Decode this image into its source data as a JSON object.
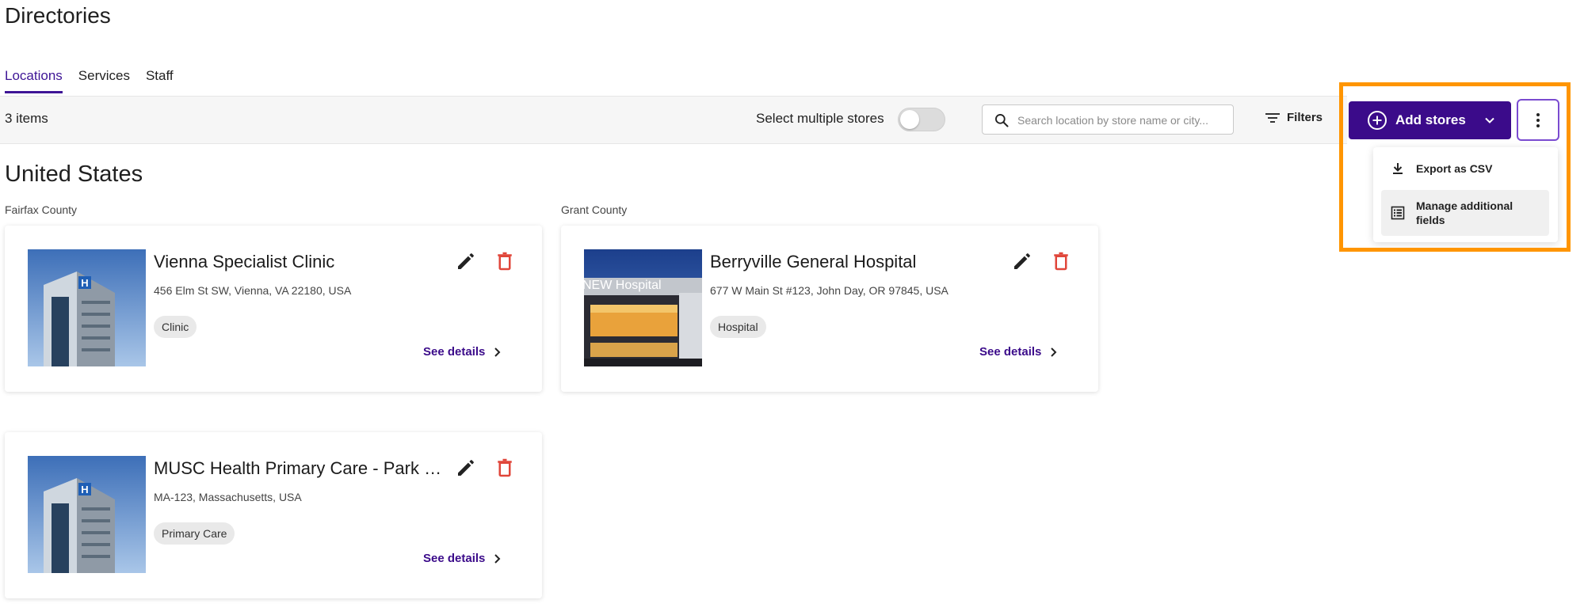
{
  "page": {
    "title": "Directories"
  },
  "tabs": [
    {
      "label": "Locations",
      "active": true
    },
    {
      "label": "Services",
      "active": false
    },
    {
      "label": "Staff",
      "active": false
    }
  ],
  "toolbar": {
    "item_count": "3 items",
    "multi_select_label": "Select multiple stores",
    "multi_select_on": false,
    "search_placeholder": "Search location by store name or city...",
    "filters_label": "Filters",
    "add_stores_label": "Add stores"
  },
  "menu": {
    "items": [
      {
        "label": "Export as CSV",
        "icon": "download-icon"
      },
      {
        "label": "Manage additional fields",
        "icon": "list-icon"
      }
    ]
  },
  "region": {
    "title": "United States"
  },
  "groups": [
    {
      "county": "Fairfax County"
    },
    {
      "county": "Grant County"
    }
  ],
  "cards": [
    {
      "name": "Vienna Specialist Clinic",
      "address": "456 Elm St SW, Vienna, VA 22180, USA",
      "tag": "Clinic",
      "details_label": "See details"
    },
    {
      "name": "Berryville General Hospital",
      "address": "677 W Main St #123, John Day, OR 97845, USA",
      "tag": "Hospital",
      "details_label": "See details",
      "photo_sign": "NEW Hospital"
    },
    {
      "name": "MUSC Health Primary Care - Park W...",
      "address": "MA-123, Massachusetts, USA",
      "tag": "Primary Care",
      "details_label": "See details"
    }
  ],
  "colors": {
    "accent": "#3b0b8a",
    "highlight": "#ff9500",
    "delete": "#e0463a"
  }
}
